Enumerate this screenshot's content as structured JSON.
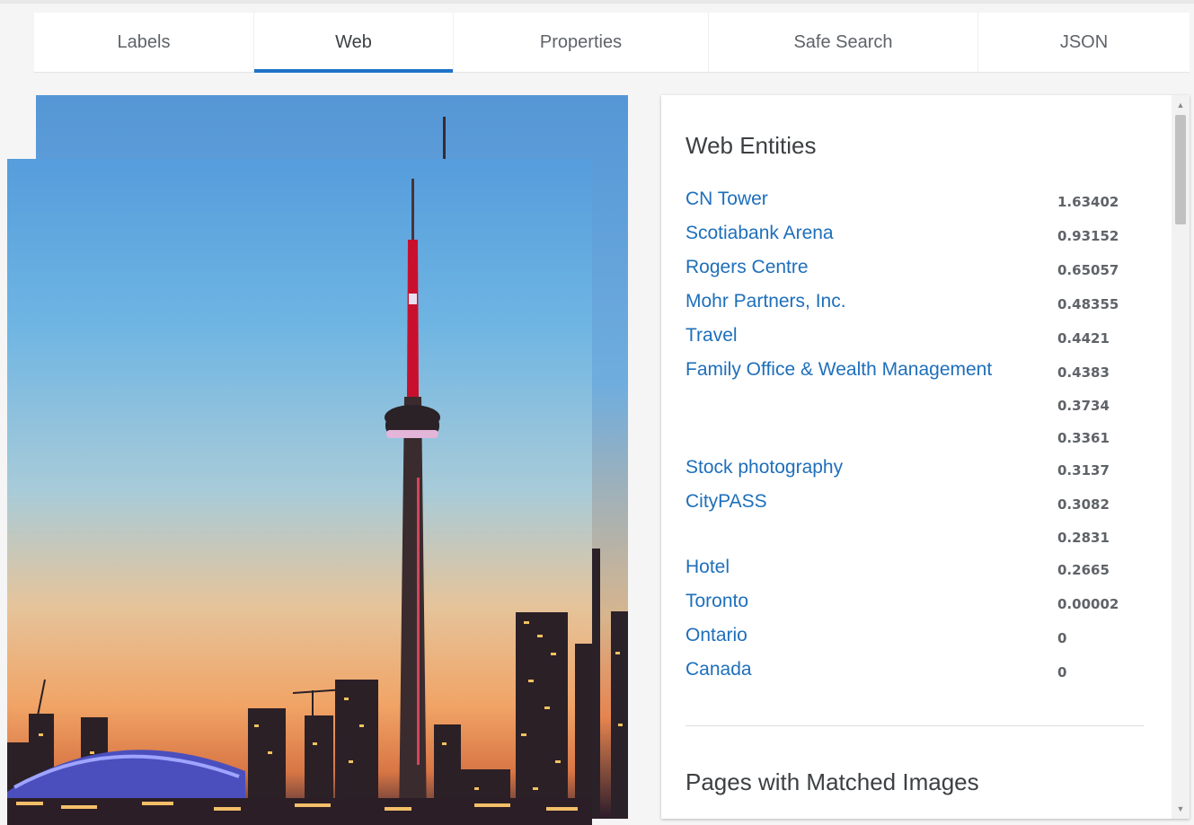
{
  "tabs": [
    {
      "label": "Labels",
      "active": false
    },
    {
      "label": "Web",
      "active": true
    },
    {
      "label": "Properties",
      "active": false
    },
    {
      "label": "Safe Search",
      "active": false
    },
    {
      "label": "JSON",
      "active": false
    }
  ],
  "web_entities": {
    "title": "Web Entities",
    "items": [
      {
        "name": "CN Tower",
        "score": "1.63402"
      },
      {
        "name": "Scotiabank Arena",
        "score": "0.93152"
      },
      {
        "name": "Rogers Centre",
        "score": "0.65057"
      },
      {
        "name": "Mohr Partners, Inc.",
        "score": "0.48355"
      },
      {
        "name": "Travel",
        "score": "0.4421"
      },
      {
        "name": "Family Office & Wealth Management",
        "score": "0.4383"
      },
      {
        "name": "",
        "score": "0.3734"
      },
      {
        "name": "",
        "score": "0.3361"
      },
      {
        "name": "Stock photography",
        "score": "0.3137"
      },
      {
        "name": "CityPASS",
        "score": "0.3082"
      },
      {
        "name": "",
        "score": "0.2831"
      },
      {
        "name": "Hotel",
        "score": "0.2665"
      },
      {
        "name": "Toronto",
        "score": "0.00002"
      },
      {
        "name": "Ontario",
        "score": "0"
      },
      {
        "name": "Canada",
        "score": "0"
      }
    ]
  },
  "pages_section": {
    "title": "Pages with Matched Images"
  },
  "colors": {
    "accent": "#1e73c9",
    "link": "#1e6fbb"
  }
}
